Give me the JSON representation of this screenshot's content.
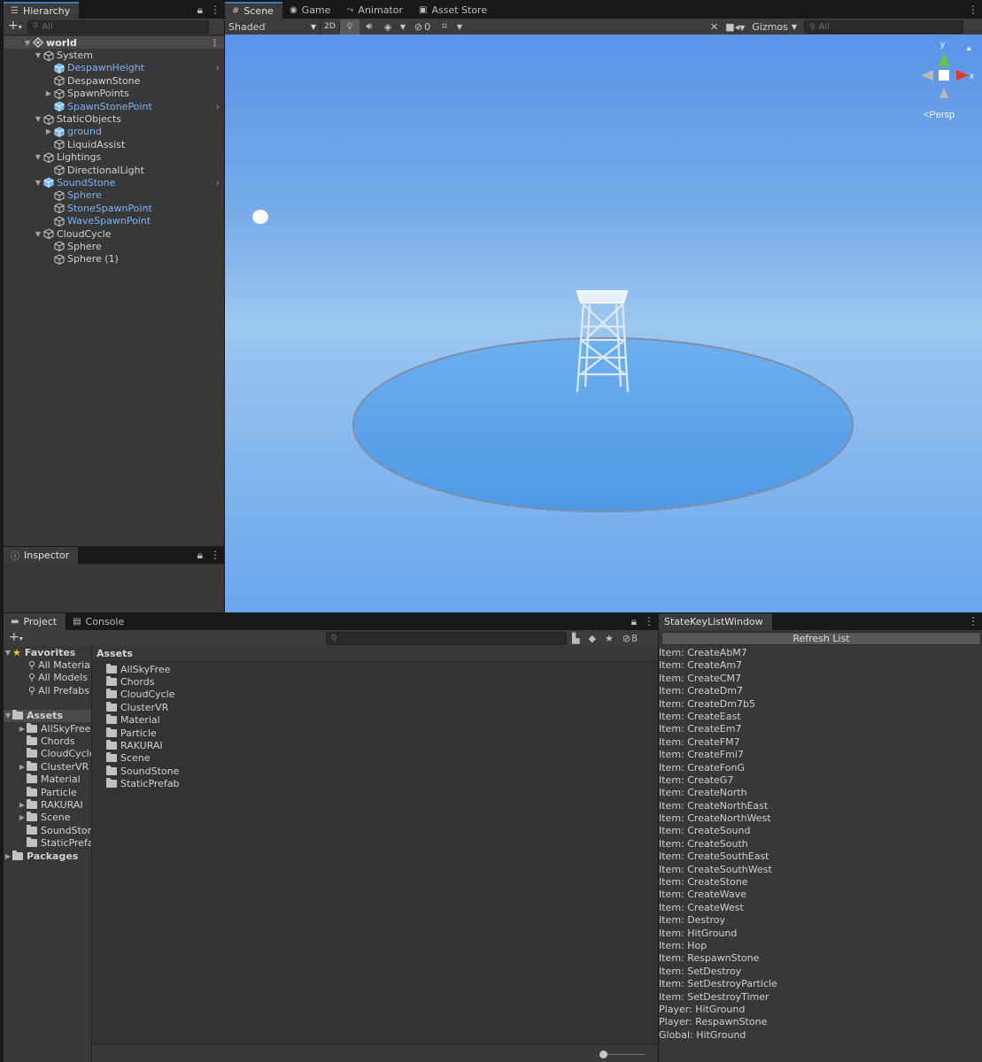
{
  "hierarchy": {
    "tab": "Hierarchy",
    "search_placeholder": "All",
    "items": [
      {
        "label": "world",
        "depth": 0,
        "expand": "open",
        "kind": "scene"
      },
      {
        "label": "System",
        "depth": 1,
        "expand": "open",
        "kind": "go"
      },
      {
        "label": "DespawnHeight",
        "depth": 2,
        "expand": "none",
        "kind": "prefab",
        "more": true
      },
      {
        "label": "DespawnStone",
        "depth": 2,
        "expand": "none",
        "kind": "go"
      },
      {
        "label": "SpawnPoints",
        "depth": 2,
        "expand": "closed",
        "kind": "go"
      },
      {
        "label": "SpawnStonePoint",
        "depth": 2,
        "expand": "none",
        "kind": "prefab",
        "more": true
      },
      {
        "label": "StaticObjects",
        "depth": 1,
        "expand": "open",
        "kind": "go"
      },
      {
        "label": "ground",
        "depth": 2,
        "expand": "closed",
        "kind": "prefab"
      },
      {
        "label": "LiquidAssist",
        "depth": 2,
        "expand": "none",
        "kind": "go"
      },
      {
        "label": "Lightings",
        "depth": 1,
        "expand": "open",
        "kind": "go"
      },
      {
        "label": "DirectionalLight",
        "depth": 2,
        "expand": "none",
        "kind": "go"
      },
      {
        "label": "SoundStone",
        "depth": 1,
        "expand": "open",
        "kind": "prefab",
        "more": true
      },
      {
        "label": "Sphere",
        "depth": 2,
        "expand": "none",
        "kind": "prefab-child"
      },
      {
        "label": "StoneSpawnPoint",
        "depth": 2,
        "expand": "none",
        "kind": "prefab-child"
      },
      {
        "label": "WaveSpawnPoint",
        "depth": 2,
        "expand": "none",
        "kind": "prefab-child"
      },
      {
        "label": "CloudCycle",
        "depth": 1,
        "expand": "open",
        "kind": "go"
      },
      {
        "label": "Sphere",
        "depth": 2,
        "expand": "none",
        "kind": "go"
      },
      {
        "label": "Sphere (1)",
        "depth": 2,
        "expand": "none",
        "kind": "go"
      }
    ]
  },
  "inspector": {
    "tab": "Inspector"
  },
  "scene": {
    "tabs": [
      "Scene",
      "Game",
      "Animator",
      "Asset Store"
    ],
    "shading_mode": "Shaded",
    "mode_2d": "2D",
    "hidden_count": "0",
    "gizmos": "Gizmos",
    "search_placeholder": "All",
    "axis_y": "y",
    "axis_x": "x",
    "projection": "Persp"
  },
  "project": {
    "tabs": [
      "Project",
      "Console"
    ],
    "hidden_count": "8",
    "favorites_label": "Favorites",
    "favorites": [
      "All Materials",
      "All Models",
      "All Prefabs"
    ],
    "assets_label": "Assets",
    "asset_tree": [
      {
        "label": "AllSkyFree",
        "expand": true
      },
      {
        "label": "Chords",
        "expand": false
      },
      {
        "label": "CloudCycle",
        "expand": false
      },
      {
        "label": "ClusterVR",
        "expand": true
      },
      {
        "label": "Material",
        "expand": false
      },
      {
        "label": "Particle",
        "expand": false
      },
      {
        "label": "RAKURAI",
        "expand": true
      },
      {
        "label": "Scene",
        "expand": true
      },
      {
        "label": "SoundStone",
        "expand": false
      },
      {
        "label": "StaticPrefab",
        "expand": false
      }
    ],
    "packages_label": "Packages",
    "breadcrumb": "Assets",
    "folders": [
      "AllSkyFree",
      "Chords",
      "CloudCycle",
      "ClusterVR",
      "Material",
      "Particle",
      "RAKURAI",
      "Scene",
      "SoundStone",
      "StaticPrefab"
    ]
  },
  "statekey": {
    "tab": "StateKeyListWindow",
    "refresh_label": "Refresh List",
    "items": [
      "Item: CreateAbM7",
      "Item: CreateAm7",
      "Item: CreateCM7",
      "Item: CreateDm7",
      "Item: CreateDm7b5",
      "Item: CreateEast",
      "Item: CreateEm7",
      "Item: CreateFM7",
      "Item: CreateFmi7",
      "Item: CreateFonG",
      "Item: CreateG7",
      "Item: CreateNorth",
      "Item: CreateNorthEast",
      "Item: CreateNorthWest",
      "Item: CreateSound",
      "Item: CreateSouth",
      "Item: CreateSouthEast",
      "Item: CreateSouthWest",
      "Item: CreateStone",
      "Item: CreateWave",
      "Item: CreateWest",
      "Item: Destroy",
      "Item: HitGround",
      "Item: Hop",
      "Item: RespawnStone",
      "Item: SetDestroy",
      "Item: SetDestroyParticle",
      "Item: SetDestroyTimer",
      "Player: HitGround",
      "Player: RespawnStone",
      "Global: HitGround"
    ]
  },
  "colors": {
    "accent": "#3a79bb",
    "prefab_text": "#7cb4f2",
    "panel": "#383838",
    "sky_top": "#5a93e8",
    "ground": "#5ca3ea"
  }
}
